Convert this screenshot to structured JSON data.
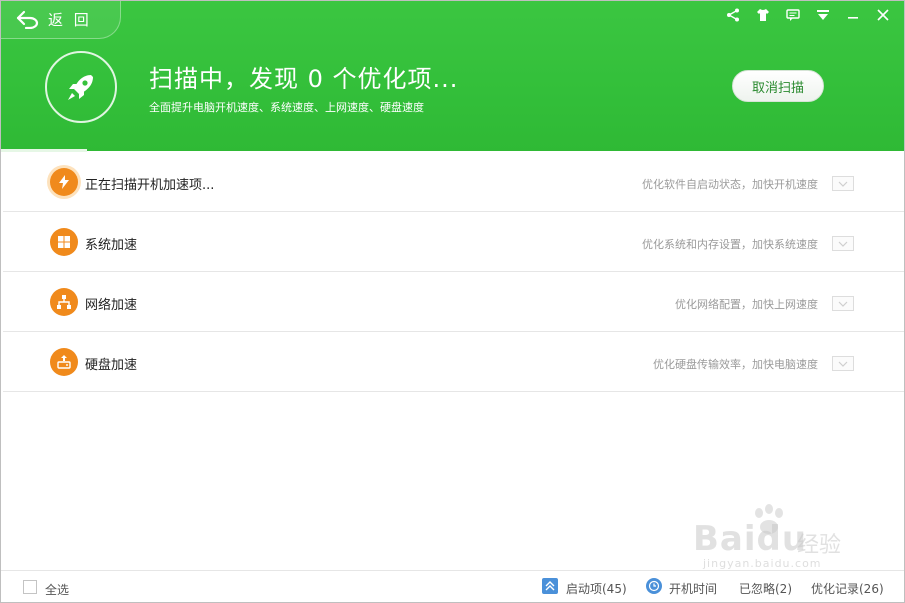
{
  "header": {
    "back_label": "返 回",
    "headline": "扫描中，发现 0 个优化项...",
    "subline": "全面提升电脑开机速度、系统速度、上网速度、硬盘速度",
    "cancel_label": "取消扫描",
    "progress_fraction": 0.095
  },
  "items": [
    {
      "name": "正在扫描开机加速项...",
      "desc": "优化软件自启动状态，加快开机速度",
      "icon": "lightning-icon",
      "scanning": true
    },
    {
      "name": "系统加速",
      "desc": "优化系统和内存设置，加快系统速度",
      "icon": "windows-icon",
      "scanning": false
    },
    {
      "name": "网络加速",
      "desc": "优化网络配置，加快上网速度",
      "icon": "network-icon",
      "scanning": false
    },
    {
      "name": "硬盘加速",
      "desc": "优化硬盘传输效率，加快电脑速度",
      "icon": "disk-icon",
      "scanning": false
    }
  ],
  "footer": {
    "select_all": "全选",
    "startup_items": "启动项(45)",
    "boot_time": "开机时间",
    "ignored": "已忽略(2)",
    "history": "优化记录(26)"
  },
  "watermark": {
    "logo": "Baidu",
    "cn": "经验",
    "sub": "jingyan.baidu.com"
  },
  "colors": {
    "header_green": "#36c23c",
    "accent_orange": "#f08a1c",
    "cancel_text": "#2a8a2f"
  }
}
